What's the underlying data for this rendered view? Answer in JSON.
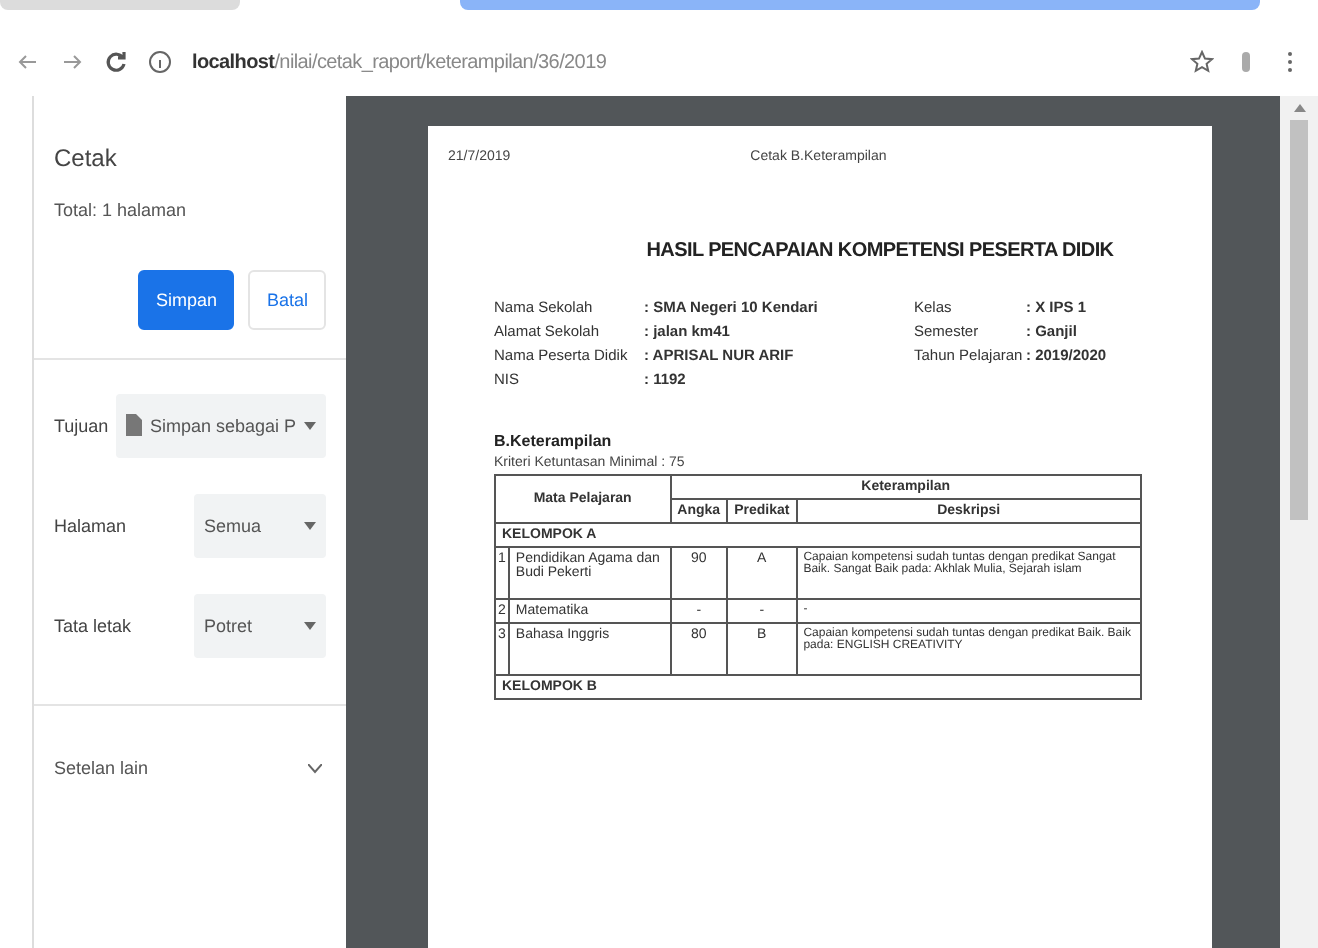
{
  "browser": {
    "url": "**localhost**/nilai/cetak_raport/keterampilan/36/2019"
  },
  "print_panel": {
    "title": "Cetak",
    "total": "Total: 1 halaman",
    "buttons": [
      {
        "label": "Simpan",
        "kind": "primary"
      },
      {
        "label": "Batal",
        "kind": "secondary"
      }
    ],
    "settings": [
      {
        "label": "Tujuan",
        "value": "Simpan sebagai P",
        "kind": "destination"
      },
      {
        "label": "Halaman",
        "value": "Semua",
        "kind": "select"
      },
      {
        "label": "Tata letak",
        "value": "Potret",
        "kind": "select"
      }
    ],
    "more": {
      "label": "Setelan lain",
      "expanded": false
    }
  },
  "document": {
    "date": "21/7/2019",
    "header": "Cetak B.Keterampilan",
    "title": "HASIL PENCAPAIAN KOMPETENSI PESERTA DIDIK",
    "info_left": [
      {
        "label": "Nama Sekolah",
        "value": ": SMA Negeri 10 Kendari"
      },
      {
        "label": "Alamat Sekolah",
        "value": ": jalan km41"
      },
      {
        "label": "Nama Peserta Didik",
        "value": ": APRISAL NUR ARIF"
      },
      {
        "label": "NIS",
        "value": ": 1192"
      }
    ],
    "info_right": [
      {
        "label": "Kelas",
        "value": ": X IPS 1"
      },
      {
        "label": "Semester",
        "value": ": Ganjil"
      },
      {
        "label": "Tahun Pelajaran",
        "value": ": 2019/2020"
      }
    ],
    "section": "B.Keterampilan",
    "kkm": "Kriteri Ketuntasan Minimal : 75",
    "table": {
      "columns": {
        "subject": "Mata Pelajaran",
        "group": "Keterampilan",
        "score": "Angka",
        "grade": "Predikat",
        "description": "Deskripsi"
      },
      "rows": [
        {
          "kind": "group",
          "label": "KELOMPOK A"
        },
        {
          "kind": "subject",
          "no": "1",
          "subject": "Pendidikan Agama dan Budi Pekerti",
          "score": "90",
          "grade": "A",
          "description": "Capaian kompetensi sudah tuntas dengan predikat Sangat Baik. Sangat Baik pada: Akhlak Mulia, Sejarah islam"
        },
        {
          "kind": "subject",
          "no": "2",
          "subject": "Matematika",
          "score": "-",
          "grade": "-",
          "description": "-"
        },
        {
          "kind": "subject",
          "no": "3",
          "subject": "Bahasa Inggris",
          "score": "80",
          "grade": "B",
          "description": "Capaian kompetensi sudah tuntas dengan predikat Baik. Baik pada: ENGLISH CREATIVITY"
        },
        {
          "kind": "group",
          "label": "KELOMPOK B"
        }
      ]
    }
  }
}
